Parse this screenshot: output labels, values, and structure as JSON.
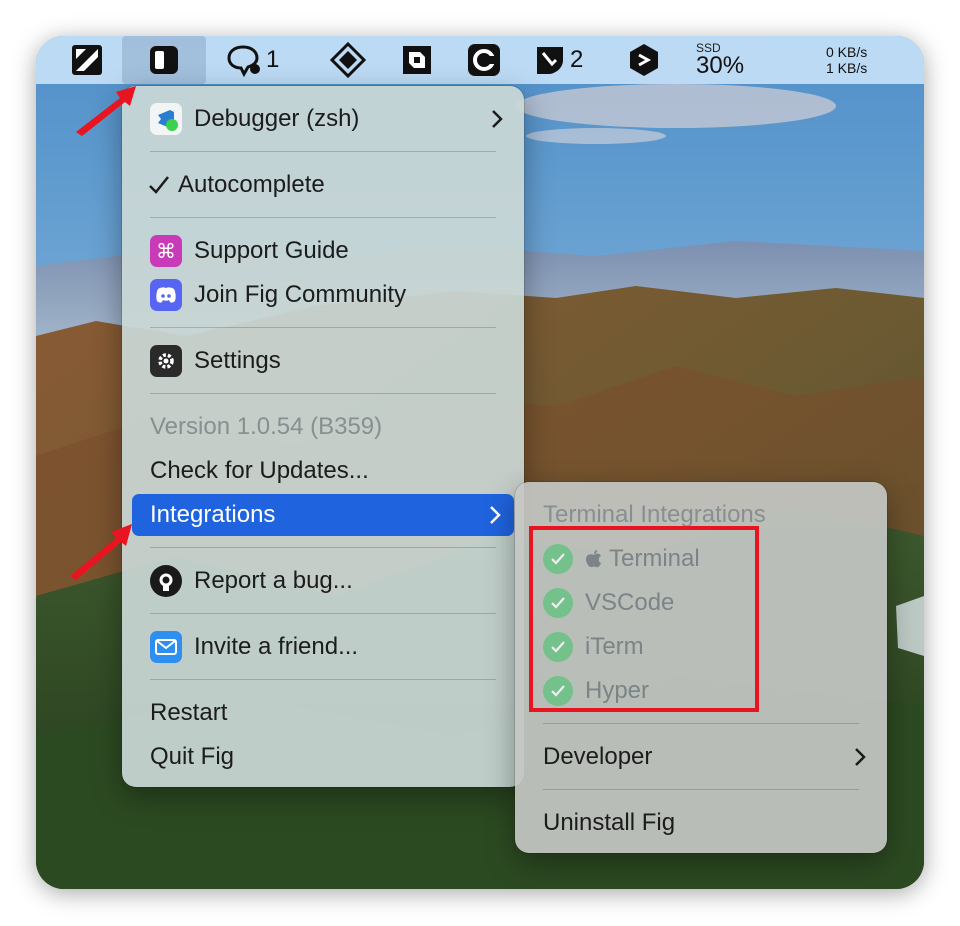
{
  "menubar": {
    "fig_badge_count": "1",
    "notifications_count": "2",
    "ssd_label": "SSD",
    "ssd_value": "30%",
    "net_down": "0 KB/s",
    "net_up": "1 KB/s",
    "icons": [
      "tiles-icon",
      "fig-icon",
      "chat-icon",
      "diamond-icon",
      "puzzle-icon",
      "cc-icon",
      "shield-icon",
      "hexagon-arrow-icon"
    ]
  },
  "main_menu": {
    "debugger_label": "Debugger (zsh)",
    "autocomplete_label": "Autocomplete",
    "support_label": "Support Guide",
    "community_label": "Join Fig Community",
    "settings_label": "Settings",
    "version_label": "Version 1.0.54 (B359)",
    "updates_label": "Check for Updates...",
    "integrations_label": "Integrations",
    "bug_label": "Report a bug...",
    "invite_label": "Invite a friend...",
    "restart_label": "Restart",
    "quit_label": "Quit Fig"
  },
  "integrations_menu": {
    "header": "Terminal Integrations",
    "items": [
      {
        "label": "Terminal",
        "checked": true
      },
      {
        "label": "VSCode",
        "checked": true
      },
      {
        "label": "iTerm",
        "checked": true
      },
      {
        "label": "Hyper",
        "checked": true
      }
    ],
    "developer_label": "Developer",
    "uninstall_label": "Uninstall Fig"
  },
  "colors": {
    "selection_blue": "#1f63de",
    "highlight_red": "#e81420",
    "check_green": "#5fc27e"
  }
}
